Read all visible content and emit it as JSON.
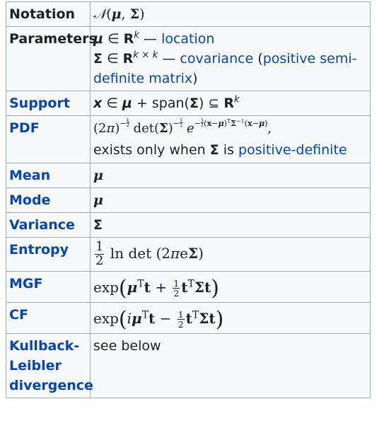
{
  "infobox": {
    "notation": {
      "label": "Notation"
    },
    "parameters": {
      "label": "Parameters",
      "mu_desc": "location",
      "sigma_desc": "covariance",
      "psd_link": "positive semi-definite matrix"
    },
    "support": {
      "label": "Support",
      "text": "span"
    },
    "pdf": {
      "label": "PDF",
      "note_prefix": "exists only when",
      "note_link": "positive-definite",
      "note_mid": "is"
    },
    "mean": {
      "label": "Mean"
    },
    "mode": {
      "label": "Mode"
    },
    "variance": {
      "label": "Variance"
    },
    "entropy": {
      "label": "Entropy"
    },
    "mgf": {
      "label": "MGF"
    },
    "cf": {
      "label": "CF"
    },
    "kl": {
      "label_line1": "Kullback-",
      "label_line2": "Leibler",
      "label_line3": "divergence",
      "value": "see below"
    }
  }
}
